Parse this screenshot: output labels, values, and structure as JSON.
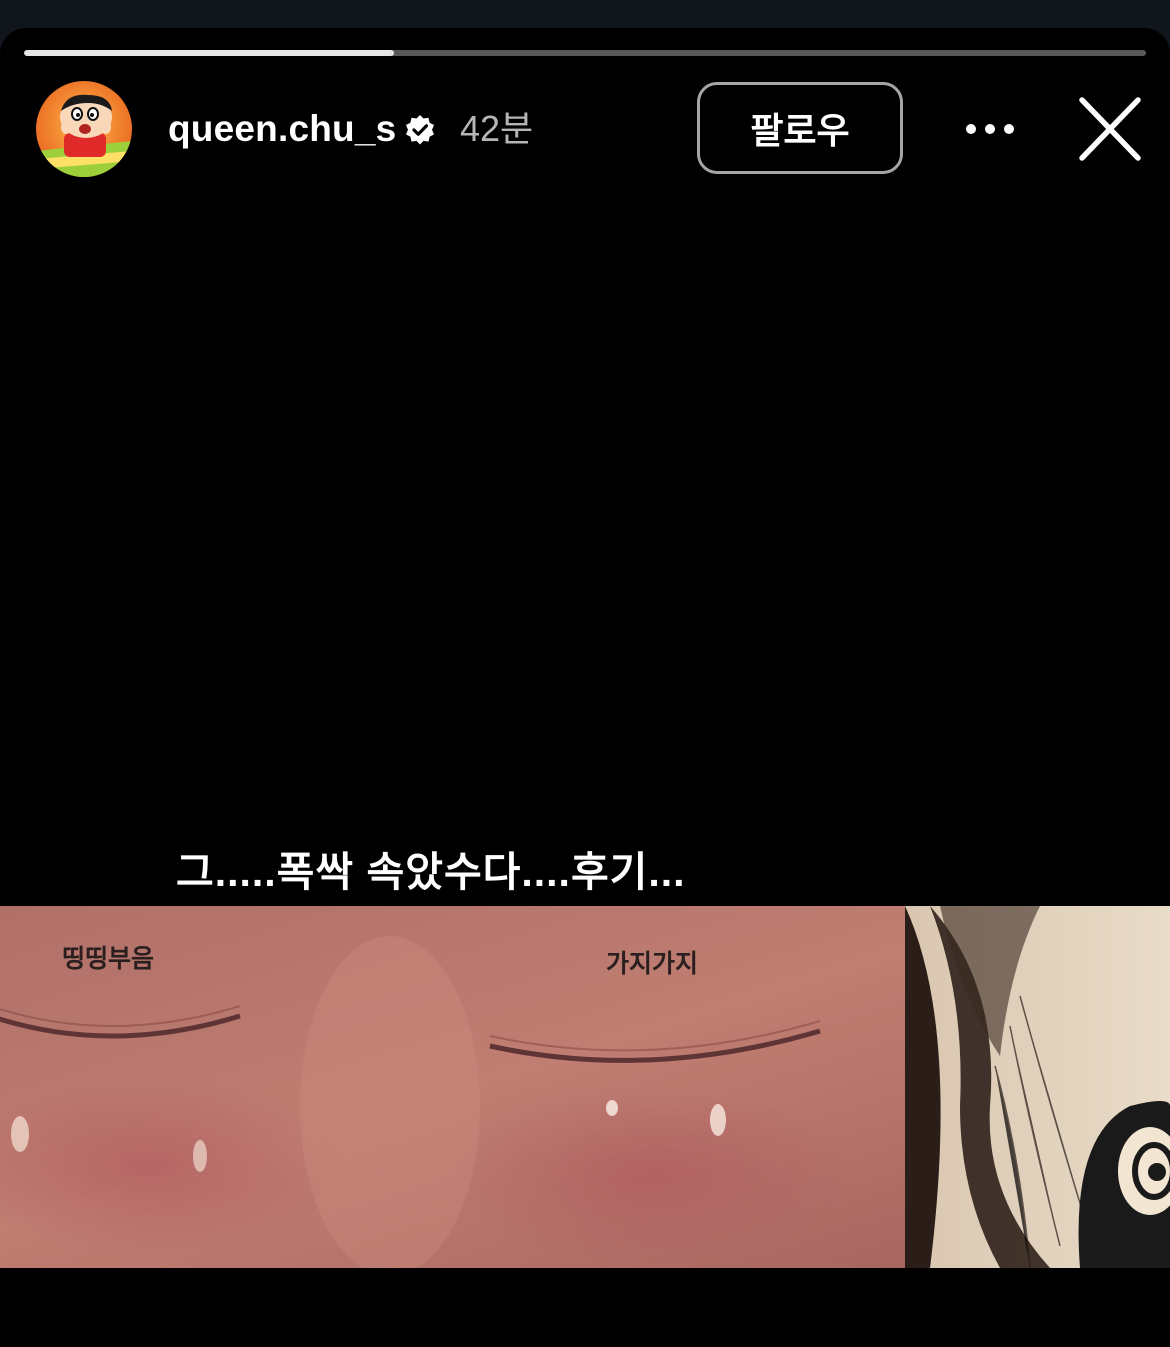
{
  "story": {
    "progress": 0.33,
    "user": {
      "username": "queen.chu_s",
      "verified": true,
      "time_ago": "42분",
      "avatar_icon": "cartoon-avatar"
    },
    "actions": {
      "follow_label": "팔로우",
      "more_icon": "ellipsis-icon",
      "close_icon": "close-icon"
    },
    "caption": "그.....폭싹 속았수다....후기...",
    "photo": {
      "labels": [
        "띵띵부음",
        "가지가지"
      ]
    }
  },
  "colors": {
    "background": "#000000",
    "progress_fill": "#d9d9d9",
    "follow_border": "#a5a5a5",
    "verified": "#ffffff"
  }
}
